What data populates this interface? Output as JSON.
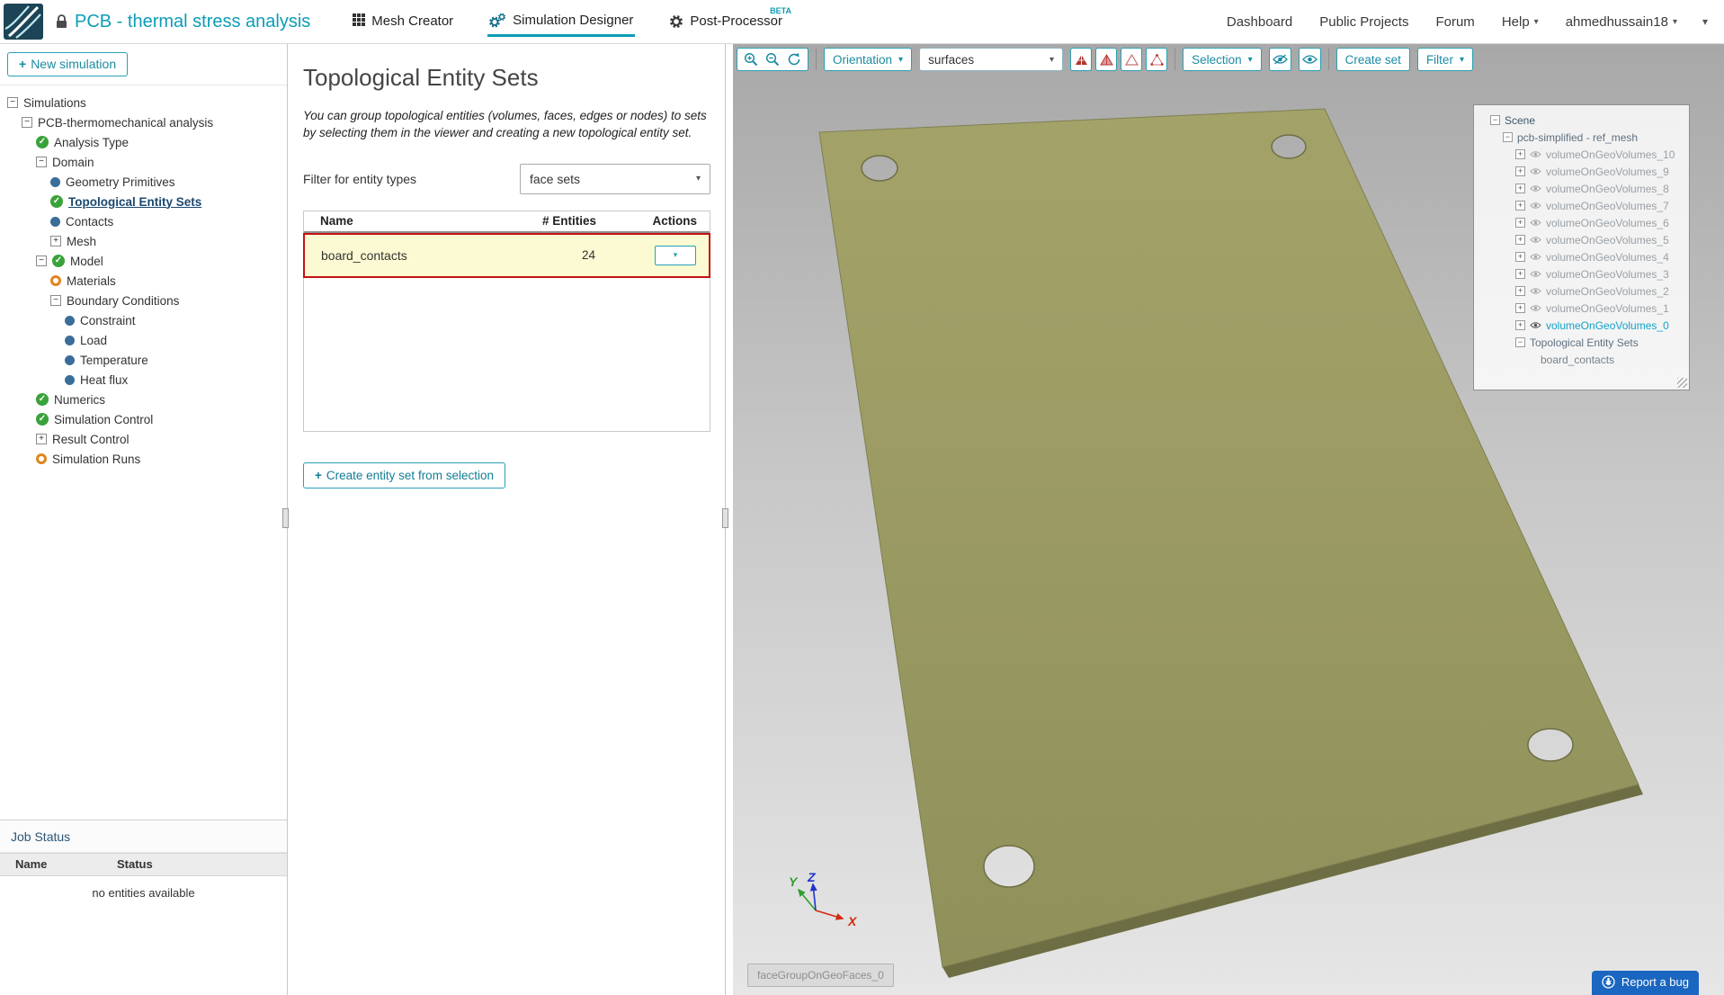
{
  "header": {
    "project_title": "PCB - thermal stress analysis",
    "tabs": [
      {
        "label": "Mesh Creator"
      },
      {
        "label": "Simulation Designer",
        "active": true
      },
      {
        "label": "Post-Processor",
        "badge": "BETA"
      }
    ],
    "nav": [
      "Dashboard",
      "Public Projects",
      "Forum",
      "Help"
    ],
    "user": "ahmedhussain18"
  },
  "sidebar": {
    "new_simulation": {
      "icon": "+",
      "label": "New simulation"
    },
    "tree": [
      {
        "label": "Simulations",
        "level": 0,
        "exp": "minus",
        "icon": null
      },
      {
        "label": "PCB-thermomechanical analysis",
        "level": 1,
        "exp": "minus",
        "icon": null
      },
      {
        "label": "Analysis Type",
        "level": 2,
        "exp": null,
        "icon": "check"
      },
      {
        "label": "Domain",
        "level": 2,
        "exp": "minus",
        "icon": null
      },
      {
        "label": "Geometry Primitives",
        "level": 3,
        "exp": null,
        "icon": "dot"
      },
      {
        "label": "Topological Entity Sets",
        "level": 3,
        "exp": null,
        "icon": "check",
        "selected": true
      },
      {
        "label": "Contacts",
        "level": 3,
        "exp": null,
        "icon": "dot"
      },
      {
        "label": "Mesh",
        "level": 3,
        "exp": "plus",
        "icon": null
      },
      {
        "label": "Model",
        "level": 2,
        "exp": "minus",
        "icon": "check"
      },
      {
        "label": "Materials",
        "level": 3,
        "exp": null,
        "icon": "warning"
      },
      {
        "label": "Boundary Conditions",
        "level": 3,
        "exp": "minus",
        "icon": null
      },
      {
        "label": "Constraint",
        "level": 4,
        "exp": null,
        "icon": "dot"
      },
      {
        "label": "Load",
        "level": 4,
        "exp": null,
        "icon": "dot"
      },
      {
        "label": "Temperature",
        "level": 4,
        "exp": null,
        "icon": "dot"
      },
      {
        "label": "Heat flux",
        "level": 4,
        "exp": null,
        "icon": "dot"
      },
      {
        "label": "Numerics",
        "level": 2,
        "exp": null,
        "icon": "check"
      },
      {
        "label": "Simulation Control",
        "level": 2,
        "exp": null,
        "icon": "check"
      },
      {
        "label": "Result Control",
        "level": 2,
        "exp": "plus",
        "icon": null
      },
      {
        "label": "Simulation Runs",
        "level": 2,
        "exp": null,
        "icon": "warning"
      }
    ],
    "job_status": {
      "title": "Job Status",
      "columns": [
        "Name",
        "Status"
      ],
      "empty_text": "no entities available"
    }
  },
  "panel": {
    "title": "Topological Entity Sets",
    "description": "You can group topological entities (volumes, faces, edges or nodes) to sets by selecting them in the viewer and creating a new topological entity set.",
    "filter_label": "Filter for entity types",
    "filter_value": "face sets",
    "table": {
      "columns": [
        "Name",
        "# Entities",
        "Actions"
      ],
      "rows": [
        {
          "name": "board_contacts",
          "entities": "24"
        }
      ]
    },
    "create_button": {
      "icon": "+",
      "label": "Create entity set from selection"
    }
  },
  "viewer": {
    "toolbar": {
      "orientation": "Orientation",
      "render_mode": "surfaces",
      "selection": "Selection",
      "create_set": "Create set",
      "filter": "Filter"
    },
    "scene_tree": {
      "root": "Scene",
      "mesh": "pcb-simplified - ref_mesh",
      "volumes": [
        "volumeOnGeoVolumes_10",
        "volumeOnGeoVolumes_9",
        "volumeOnGeoVolumes_8",
        "volumeOnGeoVolumes_7",
        "volumeOnGeoVolumes_6",
        "volumeOnGeoVolumes_5",
        "volumeOnGeoVolumes_4",
        "volumeOnGeoVolumes_3",
        "volumeOnGeoVolumes_2",
        "volumeOnGeoVolumes_1",
        "volumeOnGeoVolumes_0"
      ],
      "highlighted_volume": "volumeOnGeoVolumes_0",
      "sets_node": "Topological Entity Sets",
      "sets": [
        "board_contacts"
      ]
    },
    "axis": {
      "x": "X",
      "y": "Y",
      "z": "Z"
    },
    "tooltip": "faceGroupOnGeoFaces_0",
    "report_bug": "Report a bug"
  },
  "colors": {
    "accent": "#0c9db6",
    "board": "#9b9b62",
    "row_highlight": "#fbfad2",
    "annotation_red": "#c41212"
  }
}
